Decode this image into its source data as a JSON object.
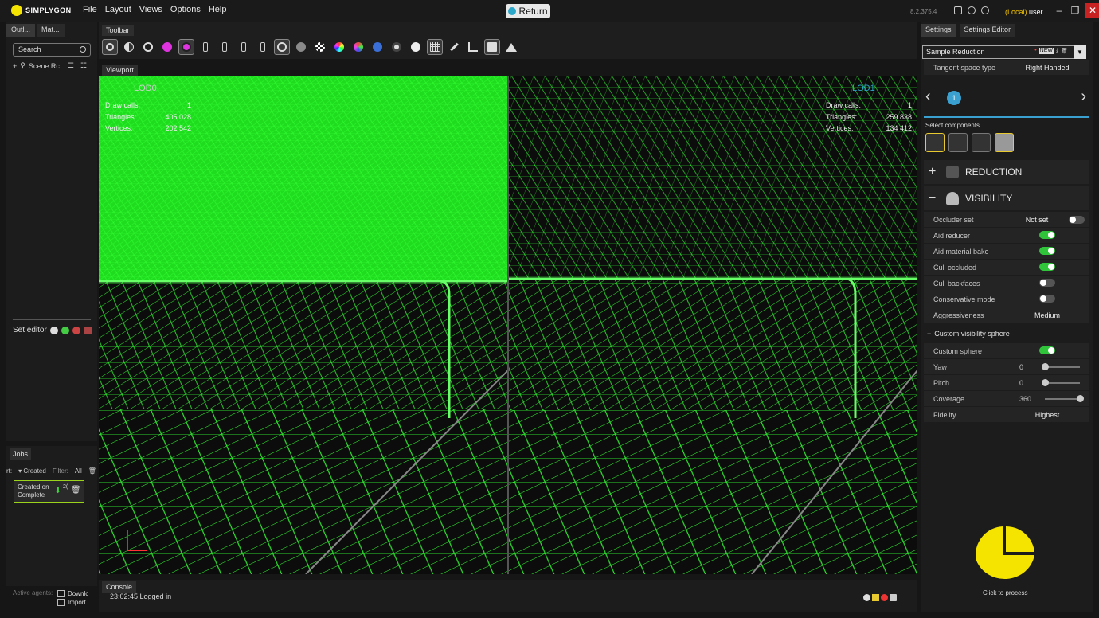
{
  "app": {
    "logo": "SIMPLYGON",
    "menu": [
      "File",
      "Layout",
      "Views",
      "Options",
      "Help"
    ],
    "return_label": "Return",
    "version": "8.2.375.4",
    "user_local": "(Local)",
    "user_name": "user"
  },
  "left": {
    "tabs": [
      "Outl...",
      "Mat..."
    ],
    "search_placeholder": "Search",
    "scene_label": "Scene Rc",
    "set_editor_label": "Set editor"
  },
  "jobs": {
    "tab": "Jobs",
    "sort_label": "rt:",
    "sort_value": "Created",
    "filter_label": "Filter:",
    "filter_value": "All",
    "card_line1": "Created on",
    "card_line2": "Complete",
    "card_num": "2(",
    "agents_label": "Active agents:",
    "agents": [
      "Downlc",
      "Import"
    ]
  },
  "toolbar": {
    "label": "Toolbar"
  },
  "viewport": {
    "label": "Viewport",
    "left": {
      "title": "LOD0",
      "draw_calls": "1",
      "triangles": "405 028",
      "vertices": "202 542"
    },
    "right": {
      "title": "LOD1",
      "draw_calls": "1",
      "triangles": "259 838",
      "vertices": "134 412"
    },
    "stat_labels": {
      "draw_calls": "Draw calls:",
      "triangles": "Triangles:",
      "vertices": "Vertices:"
    }
  },
  "console": {
    "label": "Console",
    "line": "23:02:45 Logged in"
  },
  "settings": {
    "tabs": [
      "Settings",
      "Settings Editor"
    ],
    "preset": "Sample Reduction",
    "preset_tag": "NEW",
    "tangent_label": "Tangent space type",
    "tangent_value": "Right Handed",
    "pipeline_index": "1",
    "select_components": "Select components",
    "reduction": "REDUCTION",
    "visibility": "VISIBILITY",
    "rows": [
      {
        "label": "Occluder set",
        "value": "Not set"
      },
      {
        "label": "Aid reducer",
        "toggle": "on"
      },
      {
        "label": "Aid material bake",
        "toggle": "on"
      },
      {
        "label": "Cull occluded",
        "toggle": "on"
      },
      {
        "label": "Cull backfaces",
        "toggle": "off"
      },
      {
        "label": "Conservative mode",
        "toggle": "off"
      },
      {
        "label": "Aggressiveness",
        "value": "Medium"
      }
    ],
    "custom_sphere_section": "Custom visibility sphere",
    "sphere_rows": [
      {
        "label": "Custom sphere",
        "toggle": "on"
      },
      {
        "label": "Yaw",
        "value": "0",
        "slider": 0.0
      },
      {
        "label": "Pitch",
        "value": "0",
        "slider": 0.0
      },
      {
        "label": "Coverage",
        "value": "360",
        "slider": 1.0
      },
      {
        "label": "Fidelity",
        "value": "Highest"
      }
    ],
    "process_label": "Click to process"
  },
  "colors": {
    "accent": "#f5e400",
    "wire": "#33ff33",
    "toggle_on": "#2fc43a",
    "nav_accent": "#3aa0d0"
  }
}
